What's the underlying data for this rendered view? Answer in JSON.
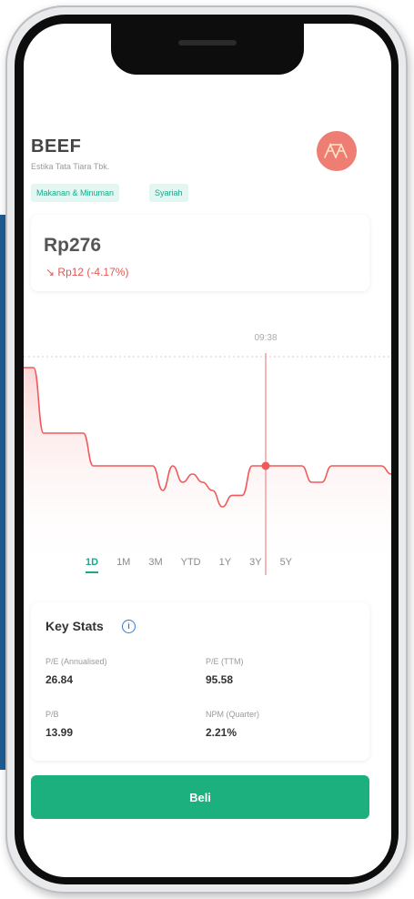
{
  "stock": {
    "ticker": "BEEF",
    "company": "Estika Tata Tiara Tbk.",
    "tags": [
      "Makanan & Minuman",
      "Syariah"
    ],
    "logo_icon": "stylized-company-logo-icon",
    "price": "Rp276",
    "change": "Rp12 (-4.17%)",
    "change_icon": "down-arrow-icon"
  },
  "chart_data": {
    "type": "line",
    "cursor_label": "09:38",
    "series": [
      {
        "values": [
          100,
          100,
          60,
          60,
          60,
          60,
          60,
          40,
          40,
          40,
          40,
          40,
          40,
          40,
          25,
          40,
          30,
          35,
          30,
          25,
          15,
          22,
          22,
          40,
          40,
          40,
          40,
          40,
          40,
          30,
          30,
          40,
          40,
          40,
          40,
          40,
          40,
          35
        ]
      }
    ],
    "colors": {
      "line": "#f05a5a",
      "fill": "#fde8e8",
      "cursor": "#e98a8a"
    }
  },
  "ranges": [
    "1D",
    "1M",
    "3M",
    "YTD",
    "1Y",
    "3Y",
    "5Y"
  ],
  "active_range": "1D",
  "key_stats": {
    "title": "Key Stats",
    "items": [
      {
        "label": "P/E (Annualised)",
        "value": "26.84"
      },
      {
        "label": "P/E (TTM)",
        "value": "95.58"
      },
      {
        "label": "P/B",
        "value": "13.99"
      },
      {
        "label": "NPM (Quarter)",
        "value": "2.21%"
      }
    ]
  },
  "buy_button": "Beli"
}
